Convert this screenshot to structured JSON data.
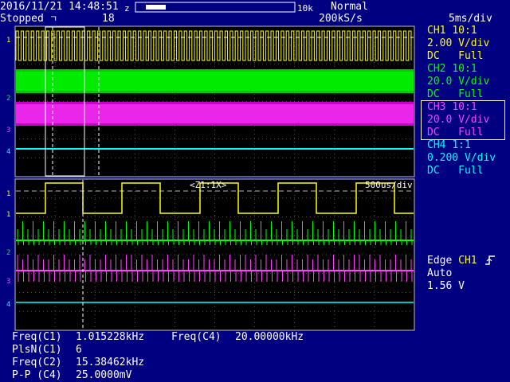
{
  "status_bar": {
    "datetime": "2016/11/21 14:48:51",
    "run_state": "Stopped",
    "trigger_marker": "ꀀ",
    "acquisition_count": "18",
    "memory_length": "10k",
    "mode": "Normal",
    "sample_rate": "200kS/s",
    "timebase": "5ms/div"
  },
  "zoom_window": {
    "label": "<Z1:1X>",
    "timebase": "500us/div"
  },
  "channels": [
    {
      "name": "CH1",
      "probe": "10:1",
      "scale": "2.00 V/div",
      "coupling": "DC",
      "bandwidth": "Full",
      "color": "#ffff00"
    },
    {
      "name": "CH2",
      "probe": "10:1",
      "scale": "20.0 V/div",
      "coupling": "DC",
      "bandwidth": "Full",
      "color": "#00ff00"
    },
    {
      "name": "CH3",
      "probe": "10:1",
      "scale": "20.0 V/div",
      "coupling": "DC",
      "bandwidth": "Full",
      "color": "#ff40ff"
    },
    {
      "name": "CH4",
      "probe": "1:1",
      "scale": "0.200 V/div",
      "coupling": "DC",
      "bandwidth": "Full",
      "color": "#00ffff"
    }
  ],
  "trigger": {
    "type": "Edge",
    "source": "CH1",
    "mode": "Auto",
    "level": "1.56 V",
    "edge_icon": "rising-edge-icon"
  },
  "measurements": [
    {
      "label": "Freq(C1)",
      "value": "1.015228kHz"
    },
    {
      "label": "Freq(C4)",
      "value": "20.00000kHz"
    },
    {
      "label": "PlsN(C1)",
      "value": "6"
    },
    {
      "label": "Freq(C2)",
      "value": "15.38462kHz"
    },
    {
      "label": "P-P (C4)",
      "value": "25.0000mV"
    }
  ],
  "colors": {
    "background": "#000080",
    "grid_bg": "#000000",
    "ch1": "#ffff00",
    "ch2": "#00ff00",
    "ch3": "#ff40ff",
    "ch4": "#00ffff"
  }
}
